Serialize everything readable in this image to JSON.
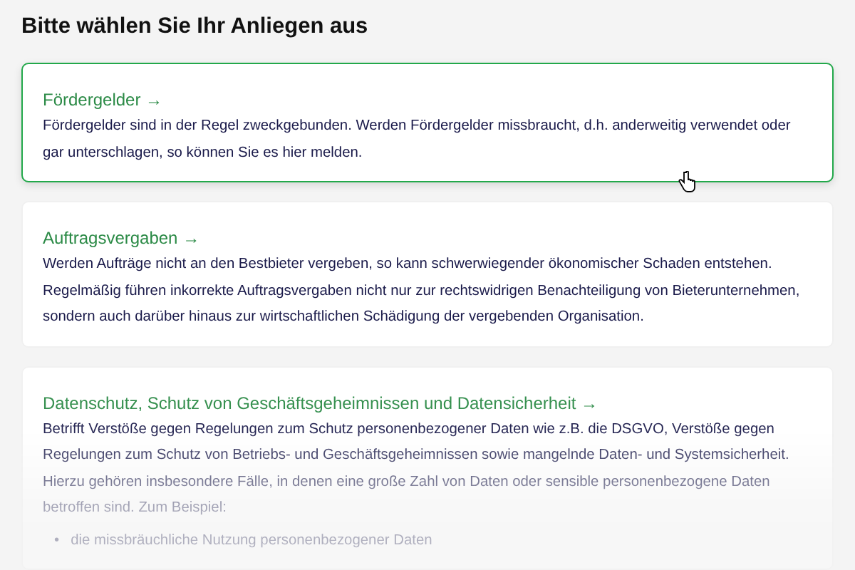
{
  "heading": "Bitte wählen Sie Ihr Anliegen aus",
  "cards": [
    {
      "title": "Fördergelder →",
      "text": "Fördergelder sind in der Regel zweckgebunden. Werden Fördergelder missbraucht, d.h. anderweitig verwendet oder gar unterschlagen, so können Sie es hier melden.",
      "selected": true,
      "faded": false
    },
    {
      "title": "Auftragsvergaben →",
      "text": "Werden Aufträge nicht an den Bestbieter vergeben, so kann schwerwiegender ökonomischer Schaden entstehen. Regelmäßig führen inkorrekte Auftragsvergaben nicht nur zur rechtswidrigen Benachteiligung von Bieterunternehmen, sondern auch darüber hinaus zur wirtschaftlichen Schädigung der vergebenden Organisation.",
      "selected": false,
      "faded": false
    },
    {
      "title": "Datenschutz, Schutz von Geschäftsgeheimnissen und Datensicherheit →",
      "text": "Betrifft Verstöße gegen Regelungen zum Schutz personenbezogener Daten wie z.B. die DSGVO, Verstöße gegen Regelungen zum Schutz von Betriebs- und Geschäftsgeheimnissen sowie mangelnde Daten- und Systemsicherheit. Hierzu gehören insbesondere Fälle, in denen eine große Zahl von Daten oder sensible personenbezogene Daten betroffen sind. Zum Beispiel:",
      "bullets": [
        {
          "marker": "•",
          "text": "die missbräuchliche Nutzung personenbezogener Daten"
        }
      ],
      "selected": false,
      "faded": true
    }
  ]
}
